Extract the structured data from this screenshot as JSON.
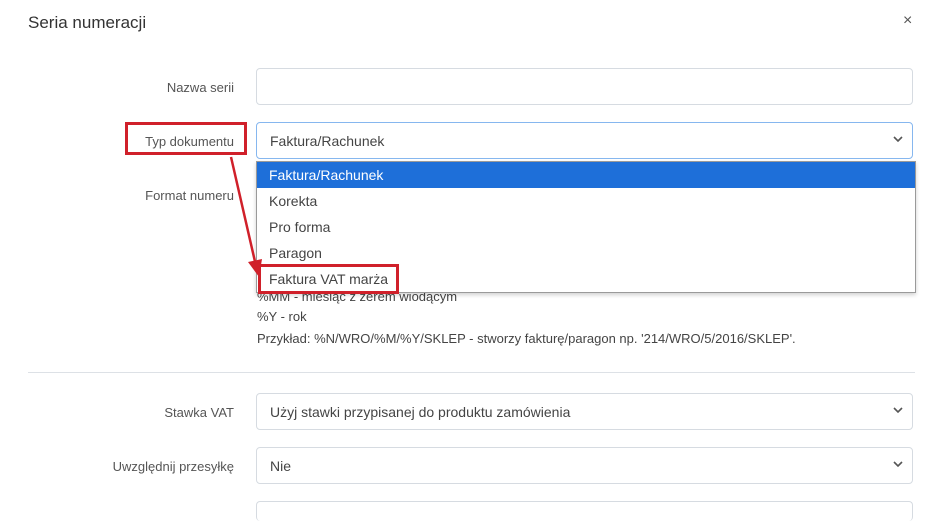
{
  "modal": {
    "title": "Seria numeracji",
    "close_symbol": "×"
  },
  "form": {
    "series_name": {
      "label": "Nazwa serii",
      "value": ""
    },
    "doc_type": {
      "label": "Typ dokumentu",
      "value": "Faktura/Rachunek",
      "options": [
        "Faktura/Rachunek",
        "Korekta",
        "Pro forma",
        "Paragon",
        "Faktura VAT marża"
      ]
    },
    "number_format": {
      "label": "Format numeru"
    },
    "help_lines": [
      "%MM - miesiąc z zerem wiodącym",
      "%Y - rok",
      "Przykład: %N/WRO/%M/%Y/SKLEP - stworzy fakturę/paragon np. '214/WRO/5/2016/SKLEP'."
    ],
    "vat_rate": {
      "label": "Stawka VAT",
      "value": "Użyj stawki przypisanej do produktu zamówienia"
    },
    "include_shipping": {
      "label": "Uwzględnij przesyłkę",
      "value": "Nie"
    }
  },
  "colors": {
    "highlight": "#1e6fd9",
    "annotation": "#d0202a"
  }
}
